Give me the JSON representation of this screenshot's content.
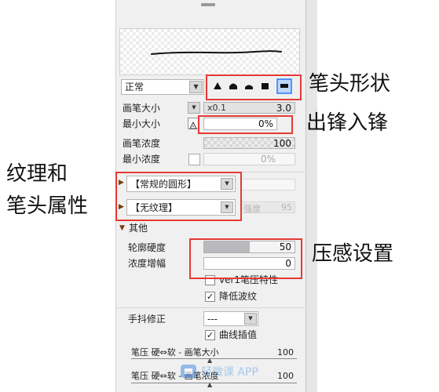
{
  "brush_panel": {
    "blend_mode": "正常",
    "tip_shapes": [
      "tip-triangle",
      "tip-dome-tall",
      "tip-dome",
      "tip-square",
      "tip-flat"
    ],
    "brush_size": {
      "label": "画笔大小",
      "scale": "x0.1",
      "value": "3.0"
    },
    "min_size": {
      "label": "最小大小",
      "value": "0%"
    },
    "brush_density": {
      "label": "画笔浓度",
      "value": "100"
    },
    "min_density": {
      "label": "最小浓度",
      "value": "0%"
    },
    "shape_dropdown": "【常规的圆形】",
    "texture_dropdown": "【无纹理】",
    "texture_strength": {
      "label": "强度",
      "value": "95"
    },
    "other_section": "其他",
    "edge_hardness": {
      "label": "轮廓硬度",
      "value": "50"
    },
    "density_amplitude": {
      "label": "浓度增幅",
      "value": "0"
    },
    "ver1_pressure": {
      "label": "ver1笔压特性",
      "checked": false
    },
    "reduce_ripple": {
      "label": "降低波纹",
      "checked": true
    },
    "stabilizer": {
      "label": "手抖修正",
      "value": "---"
    },
    "curve_interpolation": {
      "label": "曲线插值",
      "checked": true
    },
    "pressure_size": {
      "label": "笔压 硬⇔软 - 画笔大小",
      "value": "100"
    },
    "pressure_density": {
      "label": "笔压 硬⇔软 - 画笔浓度",
      "value": "100"
    }
  },
  "annotations": {
    "tip_shape": "笔头形状",
    "taper": "出锋入锋",
    "texture_line1": "纹理和",
    "texture_line2": "笔头属性",
    "pressure": "压感设置"
  },
  "watermark": "轻微课 APP",
  "colors": {
    "annotation_box": "#e53935",
    "panel_bg": "#f0f0f0",
    "selected_tip": "#2979ff"
  }
}
